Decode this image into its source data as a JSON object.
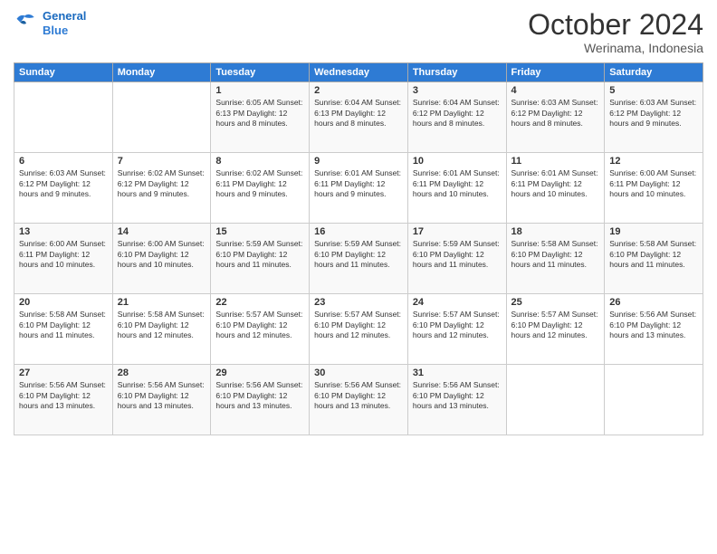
{
  "logo": {
    "line1": "General",
    "line2": "Blue"
  },
  "title": "October 2024",
  "location": "Werinama, Indonesia",
  "days_of_week": [
    "Sunday",
    "Monday",
    "Tuesday",
    "Wednesday",
    "Thursday",
    "Friday",
    "Saturday"
  ],
  "weeks": [
    [
      {
        "day": "",
        "info": ""
      },
      {
        "day": "",
        "info": ""
      },
      {
        "day": "1",
        "info": "Sunrise: 6:05 AM\nSunset: 6:13 PM\nDaylight: 12 hours and 8 minutes."
      },
      {
        "day": "2",
        "info": "Sunrise: 6:04 AM\nSunset: 6:13 PM\nDaylight: 12 hours and 8 minutes."
      },
      {
        "day": "3",
        "info": "Sunrise: 6:04 AM\nSunset: 6:12 PM\nDaylight: 12 hours and 8 minutes."
      },
      {
        "day": "4",
        "info": "Sunrise: 6:03 AM\nSunset: 6:12 PM\nDaylight: 12 hours and 8 minutes."
      },
      {
        "day": "5",
        "info": "Sunrise: 6:03 AM\nSunset: 6:12 PM\nDaylight: 12 hours and 9 minutes."
      }
    ],
    [
      {
        "day": "6",
        "info": "Sunrise: 6:03 AM\nSunset: 6:12 PM\nDaylight: 12 hours and 9 minutes."
      },
      {
        "day": "7",
        "info": "Sunrise: 6:02 AM\nSunset: 6:12 PM\nDaylight: 12 hours and 9 minutes."
      },
      {
        "day": "8",
        "info": "Sunrise: 6:02 AM\nSunset: 6:11 PM\nDaylight: 12 hours and 9 minutes."
      },
      {
        "day": "9",
        "info": "Sunrise: 6:01 AM\nSunset: 6:11 PM\nDaylight: 12 hours and 9 minutes."
      },
      {
        "day": "10",
        "info": "Sunrise: 6:01 AM\nSunset: 6:11 PM\nDaylight: 12 hours and 10 minutes."
      },
      {
        "day": "11",
        "info": "Sunrise: 6:01 AM\nSunset: 6:11 PM\nDaylight: 12 hours and 10 minutes."
      },
      {
        "day": "12",
        "info": "Sunrise: 6:00 AM\nSunset: 6:11 PM\nDaylight: 12 hours and 10 minutes."
      }
    ],
    [
      {
        "day": "13",
        "info": "Sunrise: 6:00 AM\nSunset: 6:11 PM\nDaylight: 12 hours and 10 minutes."
      },
      {
        "day": "14",
        "info": "Sunrise: 6:00 AM\nSunset: 6:10 PM\nDaylight: 12 hours and 10 minutes."
      },
      {
        "day": "15",
        "info": "Sunrise: 5:59 AM\nSunset: 6:10 PM\nDaylight: 12 hours and 11 minutes."
      },
      {
        "day": "16",
        "info": "Sunrise: 5:59 AM\nSunset: 6:10 PM\nDaylight: 12 hours and 11 minutes."
      },
      {
        "day": "17",
        "info": "Sunrise: 5:59 AM\nSunset: 6:10 PM\nDaylight: 12 hours and 11 minutes."
      },
      {
        "day": "18",
        "info": "Sunrise: 5:58 AM\nSunset: 6:10 PM\nDaylight: 12 hours and 11 minutes."
      },
      {
        "day": "19",
        "info": "Sunrise: 5:58 AM\nSunset: 6:10 PM\nDaylight: 12 hours and 11 minutes."
      }
    ],
    [
      {
        "day": "20",
        "info": "Sunrise: 5:58 AM\nSunset: 6:10 PM\nDaylight: 12 hours and 11 minutes."
      },
      {
        "day": "21",
        "info": "Sunrise: 5:58 AM\nSunset: 6:10 PM\nDaylight: 12 hours and 12 minutes."
      },
      {
        "day": "22",
        "info": "Sunrise: 5:57 AM\nSunset: 6:10 PM\nDaylight: 12 hours and 12 minutes."
      },
      {
        "day": "23",
        "info": "Sunrise: 5:57 AM\nSunset: 6:10 PM\nDaylight: 12 hours and 12 minutes."
      },
      {
        "day": "24",
        "info": "Sunrise: 5:57 AM\nSunset: 6:10 PM\nDaylight: 12 hours and 12 minutes."
      },
      {
        "day": "25",
        "info": "Sunrise: 5:57 AM\nSunset: 6:10 PM\nDaylight: 12 hours and 12 minutes."
      },
      {
        "day": "26",
        "info": "Sunrise: 5:56 AM\nSunset: 6:10 PM\nDaylight: 12 hours and 13 minutes."
      }
    ],
    [
      {
        "day": "27",
        "info": "Sunrise: 5:56 AM\nSunset: 6:10 PM\nDaylight: 12 hours and 13 minutes."
      },
      {
        "day": "28",
        "info": "Sunrise: 5:56 AM\nSunset: 6:10 PM\nDaylight: 12 hours and 13 minutes."
      },
      {
        "day": "29",
        "info": "Sunrise: 5:56 AM\nSunset: 6:10 PM\nDaylight: 12 hours and 13 minutes."
      },
      {
        "day": "30",
        "info": "Sunrise: 5:56 AM\nSunset: 6:10 PM\nDaylight: 12 hours and 13 minutes."
      },
      {
        "day": "31",
        "info": "Sunrise: 5:56 AM\nSunset: 6:10 PM\nDaylight: 12 hours and 13 minutes."
      },
      {
        "day": "",
        "info": ""
      },
      {
        "day": "",
        "info": ""
      }
    ]
  ]
}
